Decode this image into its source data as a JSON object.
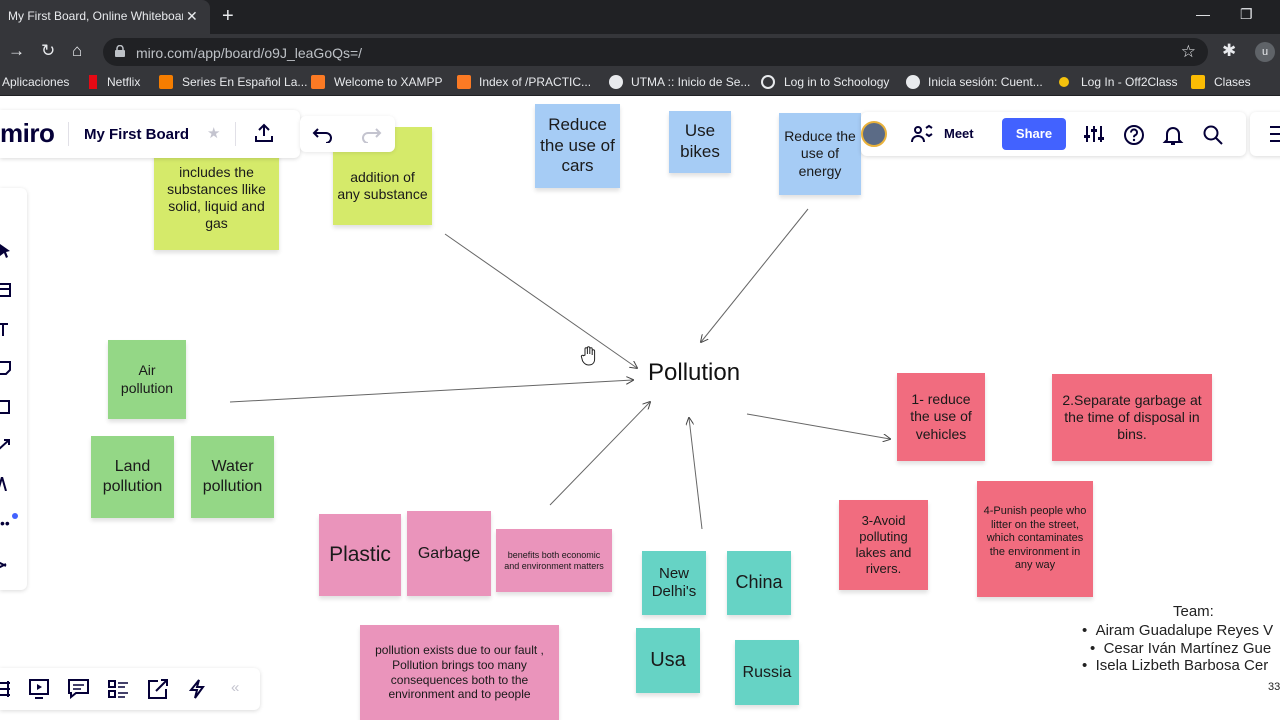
{
  "browser": {
    "tab_title": "My First Board, Online Whiteboard",
    "url": "miro.com/app/board/o9J_leaGoQs=/",
    "profile_initial": "u",
    "bookmarks": [
      {
        "label": "Aplicaciones",
        "icon": "apps-grid-icon",
        "color": "#8ab4f8"
      },
      {
        "label": "Netflix",
        "icon": "netflix-icon",
        "color": "#e50914"
      },
      {
        "label": "Series En Español La...",
        "icon": "blogger-icon",
        "color": "#f57d00"
      },
      {
        "label": "Welcome to XAMPP",
        "icon": "xampp-icon",
        "color": "#fb7a24"
      },
      {
        "label": "Index of /PRACTIC...",
        "icon": "xampp-icon",
        "color": "#fb7a24"
      },
      {
        "label": "UTMA :: Inicio de Se...",
        "icon": "globe-icon",
        "color": "#e8eaed"
      },
      {
        "label": "Log in to Schoology",
        "icon": "schoology-icon",
        "color": "#e8eaed"
      },
      {
        "label": "Inicia sesión: Cuent...",
        "icon": "google-icon",
        "color": "#e8eaed"
      },
      {
        "label": "Log In - Off2Class",
        "icon": "star-burst-icon",
        "color": "#f4c20d"
      },
      {
        "label": "Clases",
        "icon": "classroom-icon",
        "color": "#fbbc04"
      }
    ]
  },
  "miro": {
    "logo": "miro",
    "board_name": "My First Board",
    "meet_label": "Meet",
    "share_label": "Share"
  },
  "board": {
    "center_label": "Pollution",
    "notes": {
      "yellow_1": "includes the substances llike solid, liquid and gas",
      "yellow_2": "addition of any substance",
      "blue_cars": "Reduce the use of cars",
      "blue_bikes": "Use bikes",
      "blue_energy": "Reduce the use of energy",
      "green_air": "Air pollution",
      "green_land": "Land pollution",
      "green_water": "Water pollution",
      "red_1": "1- reduce the use of vehicles",
      "red_2": "2.Separate garbage at the time of disposal in bins.",
      "red_3": "3-Avoid polluting lakes and rivers.",
      "red_4": "4-Punish people who litter on the street, which contaminates the environment in any way",
      "pink_plastic": "Plastic",
      "pink_garbage": "Garbage",
      "pink_benefits": "benefits both economic and environment matters",
      "pink_fault": "pollution exists due to our fault , Pollution brings too many consequences both to the environment and to people",
      "teal_delhi": "New Delhi's",
      "teal_china": "China",
      "teal_usa": "Usa",
      "teal_russia": "Russia"
    },
    "team": {
      "title": "Team:",
      "members": [
        "Airam Guadalupe Reyes V",
        "Cesar Iván Martínez Gue",
        "Isela Lizbeth Barbosa Cer"
      ]
    },
    "page_number": "33"
  }
}
